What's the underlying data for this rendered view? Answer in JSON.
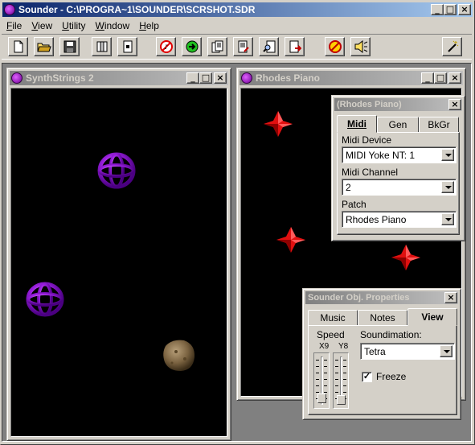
{
  "app": {
    "title": "Sounder - C:\\PROGRA~1\\SOUNDER\\SCRSHOT.SDR"
  },
  "caption_buttons": {
    "minimize": "_",
    "maximize": "□",
    "close": "×"
  },
  "menu": [
    {
      "label": "File"
    },
    {
      "label": "View"
    },
    {
      "label": "Utility"
    },
    {
      "label": "Window"
    },
    {
      "label": "Help"
    }
  ],
  "toolbar": {
    "icons": [
      "new-file-icon",
      "open-folder-icon",
      "save-disk-icon",
      "library-icon",
      "document-icon",
      "no-sound-icon",
      "go-arrow-icon",
      "pages-icon",
      "edit-page-icon",
      "find-page-icon",
      "export-page-icon",
      "stop-sound-icon",
      "speaker-icon",
      "magic-wand-icon"
    ]
  },
  "windows": {
    "synth": {
      "title": "SynthStrings 2"
    },
    "rhodes": {
      "title": "Rhodes Piano"
    }
  },
  "midi_panel": {
    "title": "(Rhodes Piano)",
    "tabs": [
      {
        "label": "Midi"
      },
      {
        "label": "Gen"
      },
      {
        "label": "BkGr"
      }
    ],
    "midi_device_label": "Midi Device",
    "midi_device_value": "MIDI Yoke NT:  1",
    "midi_channel_label": "Midi Channel",
    "midi_channel_value": "2",
    "patch_label": "Patch",
    "patch_value": "Rhodes Piano"
  },
  "props_panel": {
    "title": "Sounder Obj. Properties",
    "tabs": [
      {
        "label": "Music"
      },
      {
        "label": "Notes"
      },
      {
        "label": "View"
      }
    ],
    "speed_label": "Speed",
    "x_label": "X9",
    "y_label": "Y8",
    "soundimation_label": "Soundimation:",
    "soundimation_value": "Tetra",
    "freeze_label": "Freeze",
    "freeze_checked": "✓"
  }
}
